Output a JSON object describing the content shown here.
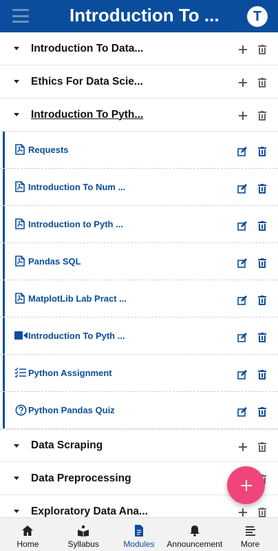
{
  "header": {
    "title": "Introduction To ...",
    "avatar_letter": "T"
  },
  "modules_top": [
    {
      "title": "Introduction To Data..."
    },
    {
      "title": "Ethics For Data Scie..."
    },
    {
      "title": "Introduction To Pyth..."
    }
  ],
  "items": [
    {
      "label": "Requests",
      "icon": "pdf-file-icon"
    },
    {
      "label": "Introduction To Num ...",
      "icon": "pdf-file-icon"
    },
    {
      "label": "Introduction to Pyth ...",
      "icon": "pdf-file-icon"
    },
    {
      "label": "Pandas SQL",
      "icon": "pdf-file-icon"
    },
    {
      "label": "MatplotLib Lab Pract ...",
      "icon": "pdf-file-icon"
    },
    {
      "label": "Introduction To Pyth ...",
      "icon": "video-icon"
    },
    {
      "label": "Python Assignment",
      "icon": "checklist-icon"
    },
    {
      "label": "Python Pandas Quiz",
      "icon": "quiz-question-icon"
    }
  ],
  "modules_bottom": [
    {
      "title": "Data Scraping"
    },
    {
      "title": "Data Preprocessing"
    },
    {
      "title": "Exploratory Data Ana..."
    }
  ],
  "bottom_nav": {
    "home": "Home",
    "syllabus": "Syllabus",
    "modules": "Modules",
    "announcement": "Announcement",
    "more": "More"
  },
  "colors": {
    "primary": "#0a4d9c",
    "fab": "#f0457a"
  }
}
